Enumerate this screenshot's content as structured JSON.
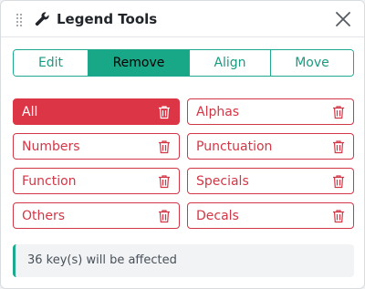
{
  "header": {
    "title": "Legend Tools",
    "drag_icon": "drag-handle-icon",
    "title_icon": "wrench-icon",
    "close_icon": "close-icon"
  },
  "tabs": [
    {
      "label": "Edit",
      "active": false
    },
    {
      "label": "Remove",
      "active": true
    },
    {
      "label": "Align",
      "active": false
    },
    {
      "label": "Move",
      "active": false
    }
  ],
  "remove_buttons": [
    {
      "label": "All",
      "selected": true
    },
    {
      "label": "Alphas",
      "selected": false
    },
    {
      "label": "Numbers",
      "selected": false
    },
    {
      "label": "Punctuation",
      "selected": false
    },
    {
      "label": "Function",
      "selected": false
    },
    {
      "label": "Specials",
      "selected": false
    },
    {
      "label": "Others",
      "selected": false
    },
    {
      "label": "Decals",
      "selected": false
    }
  ],
  "status": {
    "message": "36 key(s) will be affected"
  },
  "colors": {
    "accent": "#1ea88e",
    "danger": "#dc3545",
    "text": "#212529"
  }
}
